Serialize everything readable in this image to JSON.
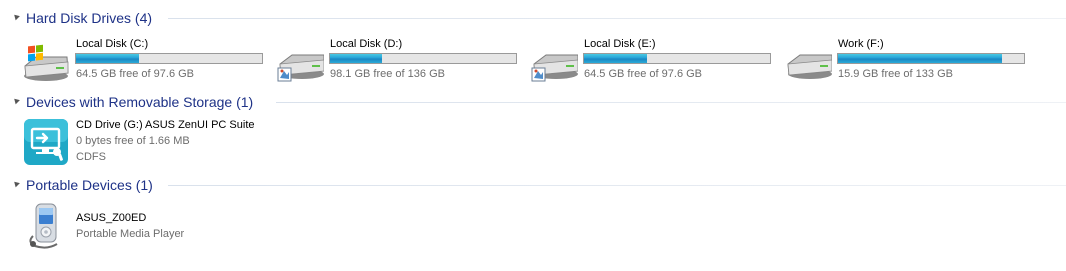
{
  "groups": [
    {
      "title": "Hard Disk Drives (4)",
      "items": [
        {
          "name": "Local Disk (C:)",
          "free": "64.5 GB free of 97.6 GB",
          "used_fraction": 0.34,
          "icon": "system-drive-icon"
        },
        {
          "name": "Local Disk (D:)",
          "free": "98.1 GB free of 136 GB",
          "used_fraction": 0.28,
          "icon": "hard-drive-icon"
        },
        {
          "name": "Local Disk (E:)",
          "free": "64.5 GB free of 97.6 GB",
          "used_fraction": 0.34,
          "icon": "hard-drive-icon"
        },
        {
          "name": "Work (F:)",
          "free": "15.9 GB free of 133 GB",
          "used_fraction": 0.88,
          "icon": "hard-drive-icon"
        }
      ]
    },
    {
      "title": "Devices with Removable Storage (1)",
      "items": [
        {
          "name": "CD Drive (G:) ASUS ZenUI PC Suite",
          "free": "0 bytes free of 1.66 MB",
          "fs": "CDFS",
          "icon": "zenui-cd-drive-icon"
        }
      ]
    },
    {
      "title": "Portable Devices (1)",
      "items": [
        {
          "name": "ASUS_Z00ED",
          "type": "Portable Media Player",
          "icon": "portable-media-player-icon"
        }
      ]
    }
  ],
  "colors": {
    "group_title": "#1e3287",
    "bar_fill": "#26a0d6",
    "secondary_text": "#6d6d6d"
  }
}
